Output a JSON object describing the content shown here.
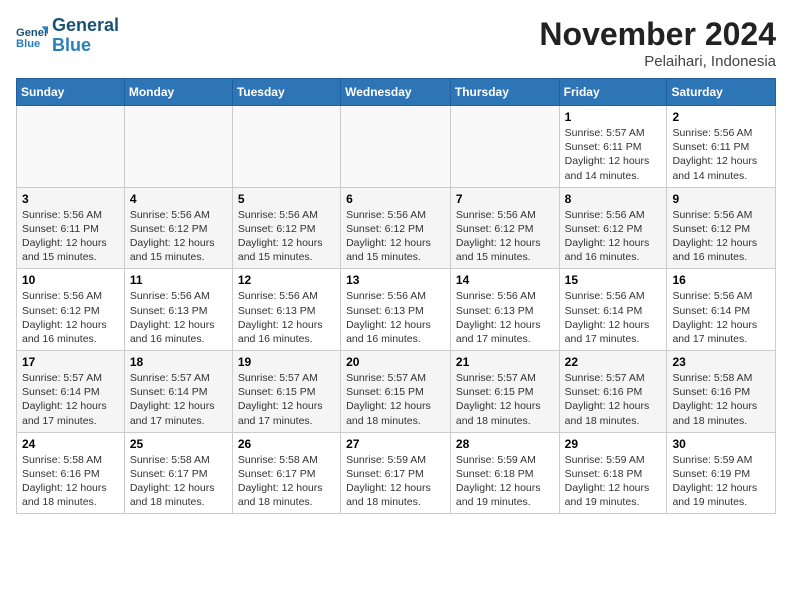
{
  "header": {
    "logo_line1": "General",
    "logo_line2": "Blue",
    "month_title": "November 2024",
    "location": "Pelaihari, Indonesia"
  },
  "days_of_week": [
    "Sunday",
    "Monday",
    "Tuesday",
    "Wednesday",
    "Thursday",
    "Friday",
    "Saturday"
  ],
  "weeks": [
    [
      {
        "day": "",
        "info": ""
      },
      {
        "day": "",
        "info": ""
      },
      {
        "day": "",
        "info": ""
      },
      {
        "day": "",
        "info": ""
      },
      {
        "day": "",
        "info": ""
      },
      {
        "day": "1",
        "info": "Sunrise: 5:57 AM\nSunset: 6:11 PM\nDaylight: 12 hours and 14 minutes."
      },
      {
        "day": "2",
        "info": "Sunrise: 5:56 AM\nSunset: 6:11 PM\nDaylight: 12 hours and 14 minutes."
      }
    ],
    [
      {
        "day": "3",
        "info": "Sunrise: 5:56 AM\nSunset: 6:11 PM\nDaylight: 12 hours and 15 minutes."
      },
      {
        "day": "4",
        "info": "Sunrise: 5:56 AM\nSunset: 6:12 PM\nDaylight: 12 hours and 15 minutes."
      },
      {
        "day": "5",
        "info": "Sunrise: 5:56 AM\nSunset: 6:12 PM\nDaylight: 12 hours and 15 minutes."
      },
      {
        "day": "6",
        "info": "Sunrise: 5:56 AM\nSunset: 6:12 PM\nDaylight: 12 hours and 15 minutes."
      },
      {
        "day": "7",
        "info": "Sunrise: 5:56 AM\nSunset: 6:12 PM\nDaylight: 12 hours and 15 minutes."
      },
      {
        "day": "8",
        "info": "Sunrise: 5:56 AM\nSunset: 6:12 PM\nDaylight: 12 hours and 16 minutes."
      },
      {
        "day": "9",
        "info": "Sunrise: 5:56 AM\nSunset: 6:12 PM\nDaylight: 12 hours and 16 minutes."
      }
    ],
    [
      {
        "day": "10",
        "info": "Sunrise: 5:56 AM\nSunset: 6:12 PM\nDaylight: 12 hours and 16 minutes."
      },
      {
        "day": "11",
        "info": "Sunrise: 5:56 AM\nSunset: 6:13 PM\nDaylight: 12 hours and 16 minutes."
      },
      {
        "day": "12",
        "info": "Sunrise: 5:56 AM\nSunset: 6:13 PM\nDaylight: 12 hours and 16 minutes."
      },
      {
        "day": "13",
        "info": "Sunrise: 5:56 AM\nSunset: 6:13 PM\nDaylight: 12 hours and 16 minutes."
      },
      {
        "day": "14",
        "info": "Sunrise: 5:56 AM\nSunset: 6:13 PM\nDaylight: 12 hours and 17 minutes."
      },
      {
        "day": "15",
        "info": "Sunrise: 5:56 AM\nSunset: 6:14 PM\nDaylight: 12 hours and 17 minutes."
      },
      {
        "day": "16",
        "info": "Sunrise: 5:56 AM\nSunset: 6:14 PM\nDaylight: 12 hours and 17 minutes."
      }
    ],
    [
      {
        "day": "17",
        "info": "Sunrise: 5:57 AM\nSunset: 6:14 PM\nDaylight: 12 hours and 17 minutes."
      },
      {
        "day": "18",
        "info": "Sunrise: 5:57 AM\nSunset: 6:14 PM\nDaylight: 12 hours and 17 minutes."
      },
      {
        "day": "19",
        "info": "Sunrise: 5:57 AM\nSunset: 6:15 PM\nDaylight: 12 hours and 17 minutes."
      },
      {
        "day": "20",
        "info": "Sunrise: 5:57 AM\nSunset: 6:15 PM\nDaylight: 12 hours and 18 minutes."
      },
      {
        "day": "21",
        "info": "Sunrise: 5:57 AM\nSunset: 6:15 PM\nDaylight: 12 hours and 18 minutes."
      },
      {
        "day": "22",
        "info": "Sunrise: 5:57 AM\nSunset: 6:16 PM\nDaylight: 12 hours and 18 minutes."
      },
      {
        "day": "23",
        "info": "Sunrise: 5:58 AM\nSunset: 6:16 PM\nDaylight: 12 hours and 18 minutes."
      }
    ],
    [
      {
        "day": "24",
        "info": "Sunrise: 5:58 AM\nSunset: 6:16 PM\nDaylight: 12 hours and 18 minutes."
      },
      {
        "day": "25",
        "info": "Sunrise: 5:58 AM\nSunset: 6:17 PM\nDaylight: 12 hours and 18 minutes."
      },
      {
        "day": "26",
        "info": "Sunrise: 5:58 AM\nSunset: 6:17 PM\nDaylight: 12 hours and 18 minutes."
      },
      {
        "day": "27",
        "info": "Sunrise: 5:59 AM\nSunset: 6:17 PM\nDaylight: 12 hours and 18 minutes."
      },
      {
        "day": "28",
        "info": "Sunrise: 5:59 AM\nSunset: 6:18 PM\nDaylight: 12 hours and 19 minutes."
      },
      {
        "day": "29",
        "info": "Sunrise: 5:59 AM\nSunset: 6:18 PM\nDaylight: 12 hours and 19 minutes."
      },
      {
        "day": "30",
        "info": "Sunrise: 5:59 AM\nSunset: 6:19 PM\nDaylight: 12 hours and 19 minutes."
      }
    ]
  ]
}
